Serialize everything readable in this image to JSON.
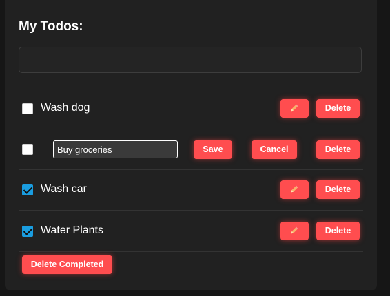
{
  "header": {
    "title": "My Todos:"
  },
  "new_todo": {
    "value": "",
    "placeholder": ""
  },
  "todos": [
    {
      "text": "Wash dog",
      "completed": false,
      "editing": false
    },
    {
      "text": "Buy groceries",
      "completed": false,
      "editing": true
    },
    {
      "text": "Wash car",
      "completed": true,
      "editing": false
    },
    {
      "text": "Water Plants",
      "completed": true,
      "editing": false
    }
  ],
  "labels": {
    "edit_icon": "pencil-icon",
    "delete": "Delete",
    "save": "Save",
    "cancel": "Cancel",
    "delete_completed": "Delete Completed"
  },
  "colors": {
    "accent": "#ff4d4f",
    "checkbox_checked": "#1a9de0",
    "background": "#212121"
  }
}
